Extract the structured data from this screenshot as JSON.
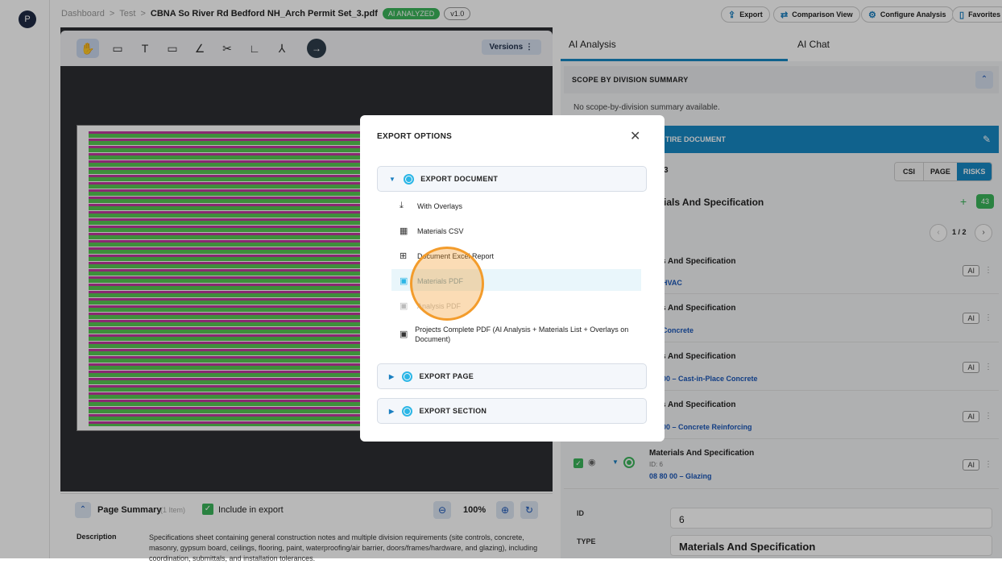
{
  "sidebar": {
    "avatar_initial": "P"
  },
  "breadcrumb": {
    "items": [
      "Dashboard",
      "Test",
      "CBNA So River Rd Bedford NH_Arch Permit Set_3.pdf"
    ],
    "separator": ">",
    "badge_analyzed": "AI ANALYZED",
    "badge_version": "v1.0"
  },
  "topbar": {
    "export_label": "Export",
    "comparison_label": "Comparison View",
    "configure_label": "Configure Analysis",
    "favorite_label": "Favorites"
  },
  "viewer": {
    "versions_label": "Versions",
    "zoom_level": "100%"
  },
  "page_summary": {
    "title": "Page Summary",
    "count_text": "(1 Item)",
    "include_label": "Include in export",
    "description_label": "Description",
    "description_text": "Specifications sheet containing general construction notes and multiple division requirements (site controls, concrete, masonry, gypsum board, ceilings, flooring, paint, waterproofing/air barrier, doors/frames/hardware, and glazing), including coordination, submittals, and installation tolerances."
  },
  "panel": {
    "tabs": [
      "AI Analysis",
      "AI Chat"
    ],
    "scope_title": "SCOPE BY DIVISION SUMMARY",
    "scope_empty": "No scope-by-division summary available.",
    "banner_title": "TIRE DOCUMENT",
    "count_text": "3",
    "filters": [
      "CSI",
      "PAGE",
      "RISKS"
    ],
    "group_title": "ials And Specification",
    "group_count": "43",
    "pagination": "1 / 2",
    "ai_label": "AI",
    "items": [
      {
        "title": "rials And Specification",
        "code": "HVAC"
      },
      {
        "title": "rials And Specification",
        "code": "Concrete"
      },
      {
        "title": "rials And Specification",
        "code": "00 – Cast-in-Place Concrete"
      },
      {
        "title": "rials And Specification",
        "code": "00 – Concrete Reinforcing"
      },
      {
        "title": "Materials And Specification",
        "id_text": "ID: 6",
        "code": "08 80 00 – Glazing"
      }
    ],
    "detail_id_label": "ID",
    "detail_id_value": "6",
    "detail_type_label": "TYPE",
    "detail_type_value": "Materials And Specification"
  },
  "modal": {
    "title": "EXPORT OPTIONS",
    "export_document_label": "EXPORT DOCUMENT",
    "options": [
      "With Overlays",
      "Materials CSV",
      "Document Excel Report",
      "Materials PDF",
      "Analysis PDF",
      "Projects Complete PDF (AI Analysis + Materials List + Overlays on Document)"
    ],
    "export_page_label": "EXPORT PAGE",
    "export_section_label": "EXPORT SECTION"
  },
  "colors": {
    "accent": "#2bb6e6",
    "banner": "#1788c4",
    "green": "#3bb55a",
    "cursor_ring": "#f39c2c"
  }
}
